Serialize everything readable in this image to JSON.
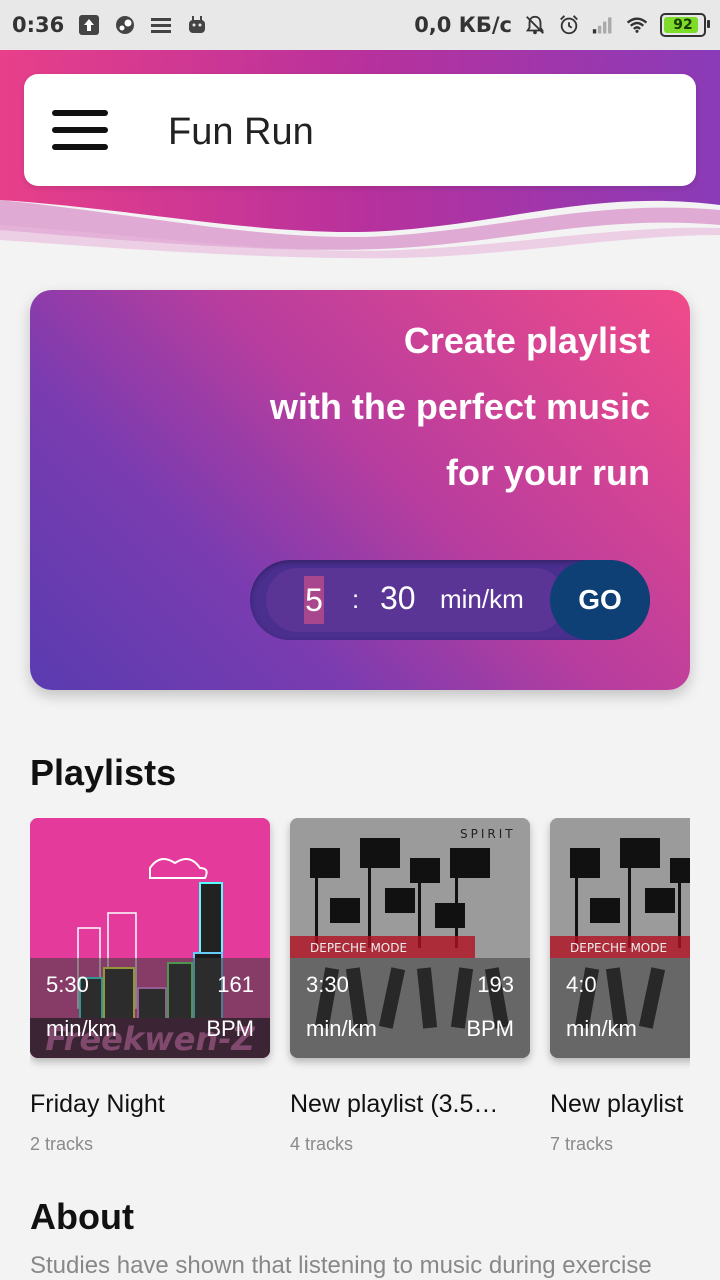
{
  "status_bar": {
    "time": "0:36",
    "net_speed": "0,0 КБ/с",
    "battery": "92",
    "icons": [
      "upload-icon",
      "steam-icon",
      "list-icon",
      "android-icon",
      "mute-bell-icon",
      "alarm-icon",
      "signal-icon",
      "wifi-icon",
      "battery-icon"
    ]
  },
  "app_bar": {
    "title": "Fun Run",
    "menu_icon": "hamburger-icon"
  },
  "hero": {
    "lines": [
      "Create playlist",
      "with the perfect music",
      "for your run"
    ],
    "pace": {
      "minutes": "5",
      "separator": ":",
      "seconds": "30",
      "unit": "min/km"
    },
    "go_label": "GO",
    "colors": {
      "start": "#5a3bb0",
      "end": "#f04b8a",
      "go": "#0e3f75"
    }
  },
  "playlists": {
    "title": "Playlists",
    "items": [
      {
        "pace": "5:30",
        "pace_unit": "min/km",
        "bpm": "161",
        "bpm_unit": "BPM",
        "name": "Friday Night",
        "tracks": "2 tracks"
      },
      {
        "pace": "3:30",
        "pace_unit": "min/km",
        "bpm": "193",
        "bpm_unit": "BPM",
        "name": "New playlist (3.5…",
        "tracks": "4 tracks"
      },
      {
        "pace": "4:0",
        "pace_unit": "min/km",
        "bpm": "",
        "bpm_unit": "",
        "name": "New playlist",
        "tracks": "7 tracks"
      }
    ]
  },
  "about": {
    "title": "About",
    "text": "Studies have shown that listening to music during exercise"
  }
}
